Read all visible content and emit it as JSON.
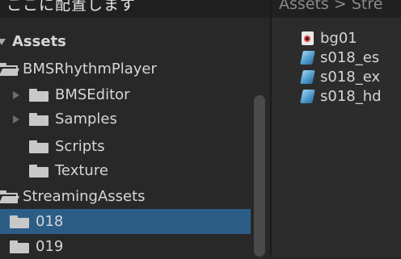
{
  "header": {
    "caption": "ここに配置します",
    "breadcrumb": "Assets > Stre"
  },
  "tree": [
    {
      "label": "Assets",
      "expanded": true,
      "root": true
    },
    {
      "label": "BMSRhythmPlayer",
      "expanded": true
    },
    {
      "label": "BMSEditor",
      "expanded": false
    },
    {
      "label": "Samples",
      "expanded": false
    },
    {
      "label": "Scripts"
    },
    {
      "label": "Texture"
    },
    {
      "label": "StreamingAssets",
      "expanded": true
    },
    {
      "label": "018",
      "selected": true
    },
    {
      "label": "019"
    }
  ],
  "files": [
    {
      "label": "bg01",
      "icon": "audio-file-icon"
    },
    {
      "label": "s018_es",
      "icon": "asset-file-icon"
    },
    {
      "label": "s018_ex",
      "icon": "asset-file-icon"
    },
    {
      "label": "s018_hd",
      "icon": "asset-file-icon"
    }
  ],
  "colors": {
    "selection": "#2c5d87",
    "background": "#282828"
  }
}
